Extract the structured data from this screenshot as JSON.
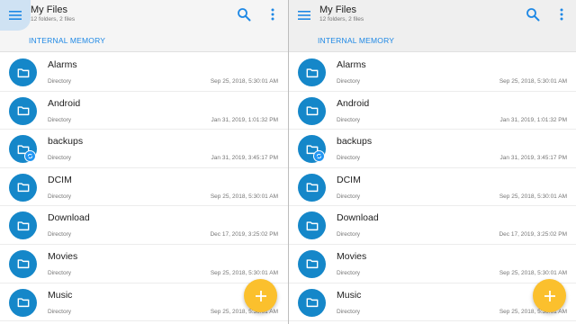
{
  "app": {
    "title": "My Files",
    "subtitle": "12 folders, 2 files",
    "breadcrumb": "INTERNAL MEMORY"
  },
  "colors": {
    "accent": "#1587c9",
    "breadcrumb": "#1e88e5",
    "fab": "#fbc02d"
  },
  "icons": {
    "menu": "hamburger-menu-icon",
    "search": "search-icon",
    "more": "more-vert-icon",
    "folder": "folder-icon",
    "badge": "sync-badge-icon",
    "fab": "plus-icon"
  },
  "files": [
    {
      "name": "Alarms",
      "type": "Directory",
      "date": "Sep 25, 2018, 5:30:01 AM",
      "badge": false
    },
    {
      "name": "Android",
      "type": "Directory",
      "date": "Jan 31, 2019, 1:01:32 PM",
      "badge": false
    },
    {
      "name": "backups",
      "type": "Directory",
      "date": "Jan 31, 2019, 3:45:17 PM",
      "badge": true
    },
    {
      "name": "DCIM",
      "type": "Directory",
      "date": "Sep 25, 2018, 5:30:01 AM",
      "badge": false
    },
    {
      "name": "Download",
      "type": "Directory",
      "date": "Dec 17, 2019, 3:25:02 PM",
      "badge": false
    },
    {
      "name": "Movies",
      "type": "Directory",
      "date": "Sep 25, 2018, 5:30:01 AM",
      "badge": false
    },
    {
      "name": "Music",
      "type": "Directory",
      "date": "Sep 25, 2018, 5:30:01 AM",
      "badge": false
    }
  ]
}
